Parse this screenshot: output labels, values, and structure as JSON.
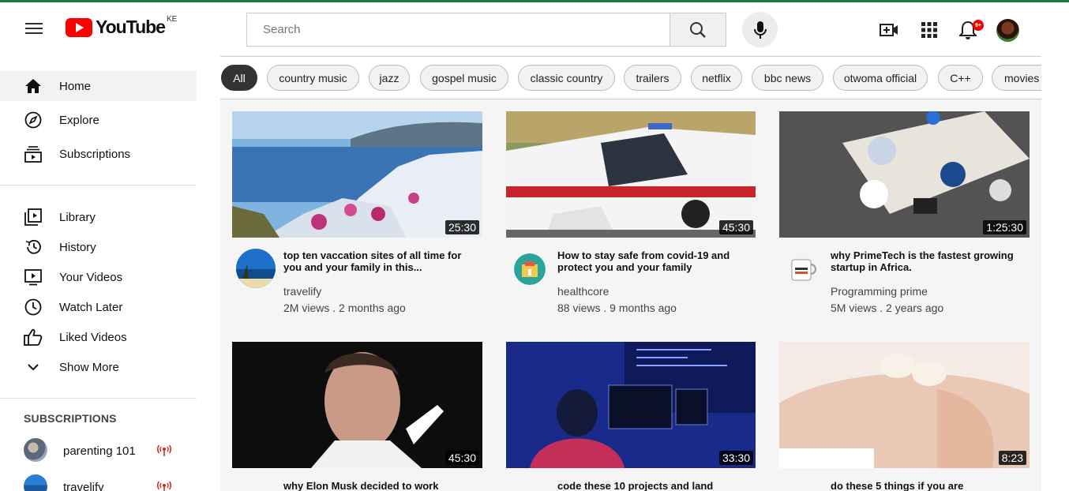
{
  "header": {
    "logo_text": "YouTube",
    "country_code": "KE",
    "search_placeholder": "Search",
    "notification_count": "9+"
  },
  "sidebar": {
    "primary": [
      {
        "label": "Home",
        "icon": "home-icon"
      },
      {
        "label": "Explore",
        "icon": "compass-icon"
      },
      {
        "label": "Subscriptions",
        "icon": "subscriptions-icon"
      }
    ],
    "secondary": [
      {
        "label": "Library",
        "icon": "library-icon"
      },
      {
        "label": "History",
        "icon": "history-icon"
      },
      {
        "label": "Your Videos",
        "icon": "your-videos-icon"
      },
      {
        "label": "Watch Later",
        "icon": "clock-icon"
      },
      {
        "label": "Liked Videos",
        "icon": "thumbs-up-icon"
      },
      {
        "label": "Show More",
        "icon": "chevron-down-icon"
      }
    ],
    "subscriptions_heading": "SUBSCRIPTIONS",
    "subscriptions": [
      {
        "label": "parenting 101"
      },
      {
        "label": "travelify"
      }
    ]
  },
  "chips": [
    "All",
    "country music",
    "jazz",
    "gospel music",
    "classic country",
    "trailers",
    "netflix",
    "bbc news",
    "otwoma official",
    "C++",
    "movies"
  ],
  "videos": [
    {
      "title": "top ten vaccation sites of all time for you and your family in this...",
      "channel": "travelify",
      "meta": "2M views . 2 months ago",
      "duration": "25:30"
    },
    {
      "title": "How to stay safe from covid-19 and protect you and your family",
      "channel": "healthcore",
      "meta": "88 views . 9 months ago",
      "duration": "45:30"
    },
    {
      "title": "why PrimeTech is the fastest growing startup in Africa.",
      "channel": "Programming prime",
      "meta": "5M views . 2 years ago",
      "duration": "1:25:30"
    },
    {
      "title": "why Elon Musk decided to work",
      "channel": "",
      "meta": "",
      "duration": "45:30"
    },
    {
      "title": "code these 10 projects and land",
      "channel": "",
      "meta": "",
      "duration": "33:30"
    },
    {
      "title": "do these 5 things if you are",
      "channel": "",
      "meta": "",
      "duration": "8:23"
    }
  ],
  "colors": {
    "brand_red": "#ff0000",
    "active_chip": "#333333",
    "live_icon": "#e02020"
  }
}
